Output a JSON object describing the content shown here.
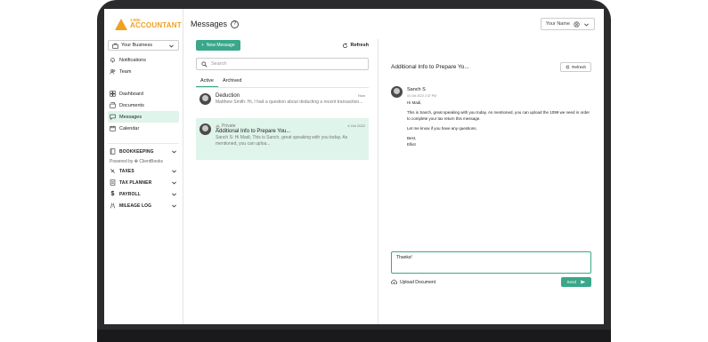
{
  "brand": {
    "line1": "1-800",
    "line2": "ACCOUNTANT",
    "accent": "#f0a020",
    "green": "#3aa78a"
  },
  "sidebar": {
    "business_label": "Your Business",
    "nav": [
      {
        "label": "Notifications",
        "icon": "bell-icon"
      },
      {
        "label": "Team",
        "icon": "team-icon"
      }
    ],
    "nav2": [
      {
        "label": "Dashboard",
        "icon": "dashboard-icon"
      },
      {
        "label": "Documents",
        "icon": "documents-icon"
      },
      {
        "label": "Messages",
        "icon": "messages-icon",
        "active": true
      },
      {
        "label": "Calendar",
        "icon": "calendar-icon"
      }
    ],
    "bookkeeping": "BOOKKEEPING",
    "powered_by": "Powered by ✤ ClientBooks",
    "sections": [
      {
        "label": "TAXES",
        "icon": "taxes-icon"
      },
      {
        "label": "TAX PLANNER",
        "icon": "planner-icon"
      },
      {
        "label": "PAYROLL",
        "icon": "dollar-icon"
      },
      {
        "label": "MILEAGE LOG",
        "icon": "mileage-icon"
      }
    ]
  },
  "header": {
    "title": "Messages",
    "help_glyph": "?",
    "user_label": "Your Name"
  },
  "list": {
    "new_button": "New Message",
    "refresh": "Refresh",
    "search_placeholder": "Search",
    "tabs": [
      "Active",
      "Archived"
    ],
    "threads": [
      {
        "subject": "Deduction",
        "date": "Now",
        "preview": "Matthew Smith: Hi, I had a question about deducting a recent transaction..."
      },
      {
        "private": "Private",
        "subject": "Additional Info to Prepare You...",
        "date": "4 Oct 2022",
        "preview": "Sanch S: Hi Madi, This is Sanch, great speaking with you today. As mentioned, you can uploa..."
      }
    ]
  },
  "detail": {
    "title": "Additional Info to Prepare Yo...",
    "refresh": "Refresh",
    "message": {
      "sender": "Sanch S",
      "date": "04 Oct 2022 2:37 PM",
      "greeting": "Hi Madi,",
      "body1": "This is Sanch, great speaking with you today. As mentioned, you can upload the 1099 we need in order to complete your tax return this message.",
      "body2": "Let me know if you have any questions.",
      "signoff1": "Best,",
      "signoff2": "Elliot"
    },
    "reply_text": "Thanks!",
    "upload_label": "Upload Document",
    "send_label": "Send"
  }
}
